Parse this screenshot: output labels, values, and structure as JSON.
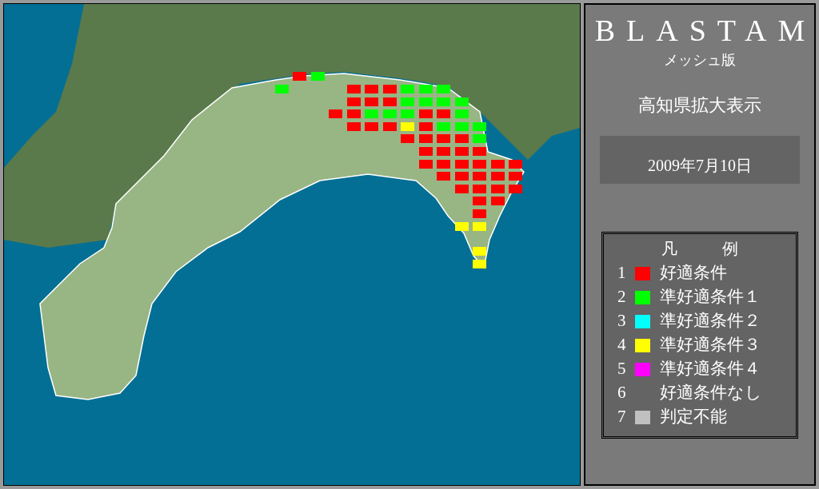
{
  "panel": {
    "title": "BLASTAM",
    "subtitle": "メッシュ版",
    "region": "高知県拡大表示",
    "date": "2009年7月10日"
  },
  "legend": {
    "title": [
      "凡",
      "例"
    ],
    "items": [
      {
        "number": "1",
        "label": "好適条件",
        "color": "#ff0000"
      },
      {
        "number": "2",
        "label": "準好適条件１",
        "color": "#00ff00"
      },
      {
        "number": "3",
        "label": "準好適条件２",
        "color": "#00ffff"
      },
      {
        "number": "4",
        "label": "準好適条件３",
        "color": "#ffff00"
      },
      {
        "number": "5",
        "label": "準好適条件４",
        "color": "#ff00ff"
      },
      {
        "number": "6",
        "label": "好適条件なし"
      },
      {
        "number": "7",
        "label": "判定不能",
        "color": "#c0c0c0"
      }
    ]
  }
}
